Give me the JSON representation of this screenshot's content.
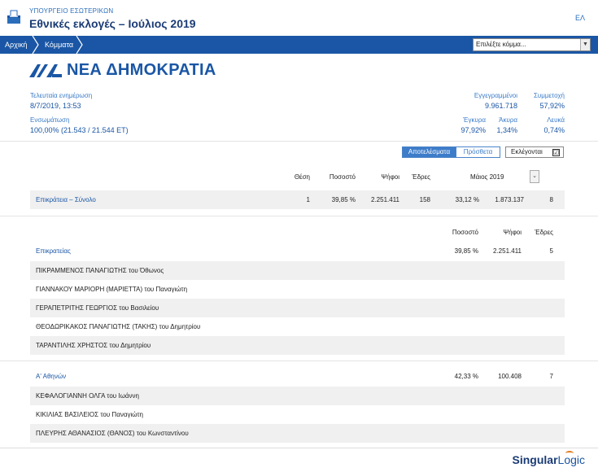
{
  "header": {
    "ministry": "ΥΠΟΥΡΓΕΙΟ ΕΣΩΤΕΡΙΚΩΝ",
    "title": "Εθνικές εκλογές – Ιούλιος 2019",
    "lang": "ΕΛ"
  },
  "nav": {
    "crumbs": [
      "Αρχική",
      "Κόμματα"
    ],
    "select_placeholder": "Επιλέξτε κόμμα..."
  },
  "party": {
    "logo": "ΝΔ",
    "name": "ΝΕΑ ΔΗΜΟΚΡΑΤΙΑ"
  },
  "stats": {
    "last_update_label": "Τελευταία ενημέρωση",
    "last_update_value": "8/7/2019, 13:53",
    "coverage_label": "Ενσωμάτωση",
    "coverage_value": "100,00% (21.543 / 21.544 ΕΤ)",
    "registered_label": "Εγγεγραμμένοι",
    "registered_value": "9.961.718",
    "turnout_label": "Συμμετοχή",
    "turnout_value": "57,92%",
    "valid_label": "Έγκυρα",
    "valid_value": "97,92%",
    "invalid_label": "Άκυρα",
    "invalid_value": "1,34%",
    "blank_label": "Λευκά",
    "blank_value": "0,74%"
  },
  "toggles": {
    "results": "Αποτελέσματα",
    "extra": "Πρόσθετα",
    "elected": "Εκλέγονται",
    "elected_check": "☑"
  },
  "summary": {
    "headers": {
      "rank": "Θέση",
      "percent": "Ποσοστό",
      "votes": "Ψήφοι",
      "seats": "Έδρες",
      "compare": "Μάιος 2019"
    },
    "row": {
      "label": "Επικράτεια – Σύνολο",
      "rank": "1",
      "percent": "39,85 %",
      "votes": "2.251.411",
      "seats": "158",
      "cmp_percent": "33,12 %",
      "cmp_votes": "1.873.137",
      "cmp_seats": "8"
    }
  },
  "constituencies_headers": {
    "percent": "Ποσοστό",
    "votes": "Ψήφοι",
    "seats": "Έδρες"
  },
  "constituencies": [
    {
      "name": "Επικρατείας",
      "percent": "39,85 %",
      "votes": "2.251.411",
      "seats": "5",
      "candidates": [
        "ΠΙΚΡΑΜΜΕΝΟΣ ΠΑΝΑΓΙΩΤΗΣ του Όθωνος",
        "ΓΙΑΝΝΑΚΟΥ ΜΑΡΙΟΡΗ (ΜΑΡΙΕΤΤΑ) του Παναγιώτη",
        "ΓΕΡΑΠΕΤΡΙΤΗΣ ΓΕΩΡΓΙΟΣ του Βασιλείου",
        "ΘΕΟΔΩΡΙΚΑΚΟΣ ΠΑΝΑΓΙΩΤΗΣ (ΤΑΚΗΣ) του Δημητρίου",
        "ΤΑΡΑΝΤΙΛΗΣ ΧΡΗΣΤΟΣ του Δημητρίου"
      ]
    },
    {
      "name": "Α' Αθηνών",
      "percent": "42,33 %",
      "votes": "100.408",
      "seats": "7",
      "candidates": [
        "ΚΕΦΑΛΟΓΙΑΝΝΗ ΟΛΓΑ του Ιωάννη",
        "ΚΙΚΙΛΙΑΣ ΒΑΣΙΛΕΙΟΣ του Παναγιώτη",
        "ΠΛΕΥΡΗΣ ΑΘΑΝΑΣΙΟΣ (ΘΑΝΟΣ) του Κωνσταντίνου"
      ]
    }
  ],
  "footer": {
    "brand_a": "Singular",
    "brand_b": "Logic"
  },
  "colors": {
    "accent": "#1a56a5",
    "nav": "#1a56a5",
    "brand_orange": "#e07a1a"
  }
}
